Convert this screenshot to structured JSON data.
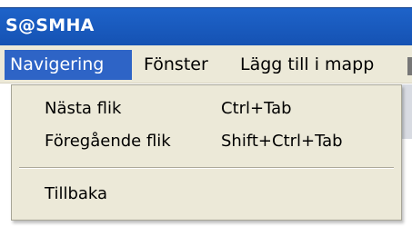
{
  "window": {
    "title": "S@SMHA"
  },
  "menubar": {
    "items": [
      {
        "label": "Navigering",
        "active": true
      },
      {
        "label": "Fönster"
      },
      {
        "label": "Lägg till i mapp"
      }
    ]
  },
  "dropdown": {
    "items": [
      {
        "label": "Nästa flik",
        "shortcut": "Ctrl+Tab"
      },
      {
        "label": "Föregående flik",
        "shortcut": "Shift+Ctrl+Tab"
      },
      {
        "label": "Tillbaka"
      }
    ]
  },
  "colors": {
    "titlebar": "#1552b3",
    "menu_active": "#2e64c6",
    "menu_bg": "#ece9d8"
  }
}
